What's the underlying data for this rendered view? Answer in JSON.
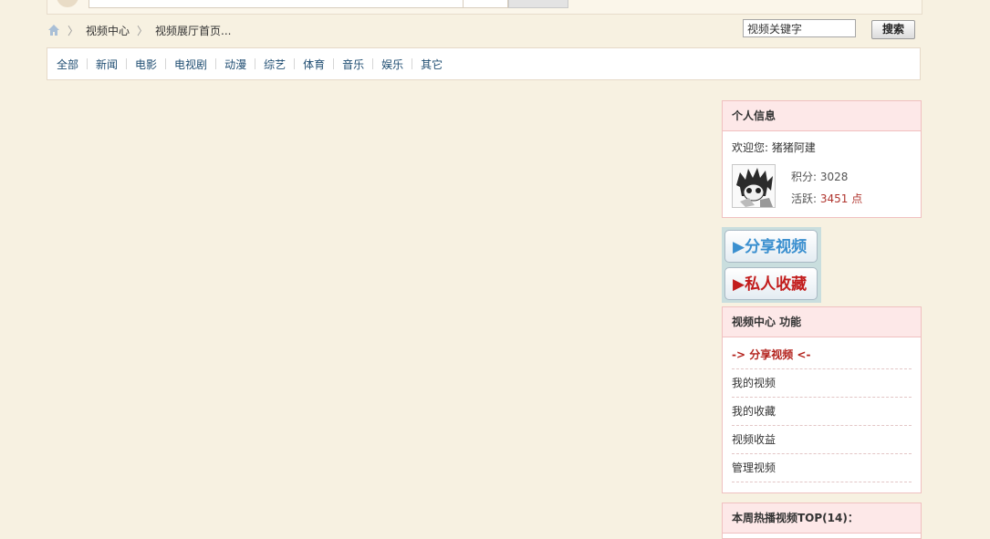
{
  "breadcrumb": {
    "items": [
      "视频中心",
      "视频展厅首页..."
    ]
  },
  "search": {
    "placeholder": "视频关键字",
    "button_label": "搜索"
  },
  "categories": [
    "全部",
    "新闻",
    "电影",
    "电视剧",
    "动漫",
    "综艺",
    "体育",
    "音乐",
    "娱乐",
    "其它"
  ],
  "profile": {
    "title": "个人信息",
    "welcome": "欢迎您: 猪猪阿建",
    "points_label": "积分: ",
    "points_value": "3028",
    "activity_label": "活跃: ",
    "activity_value": "3451 点"
  },
  "actions": {
    "share": "▶分享视频",
    "favorite": "▶私人收藏"
  },
  "functions": {
    "title": "视频中心 功能",
    "items": [
      "-> 分享视频 <-",
      "我的视频",
      "我的收藏",
      "视频收益",
      "管理视频"
    ]
  },
  "top_panel": {
    "title": "本周热播视频TOP(14)："
  },
  "colors": {
    "page_bg": "#f7f1e1",
    "panel_border": "#f0c0c0",
    "panel_head_bg": "#fde8e8",
    "accent_red": "#b3231d",
    "share_blue": "#3a8fcf",
    "nav_link": "#1f4d72"
  }
}
